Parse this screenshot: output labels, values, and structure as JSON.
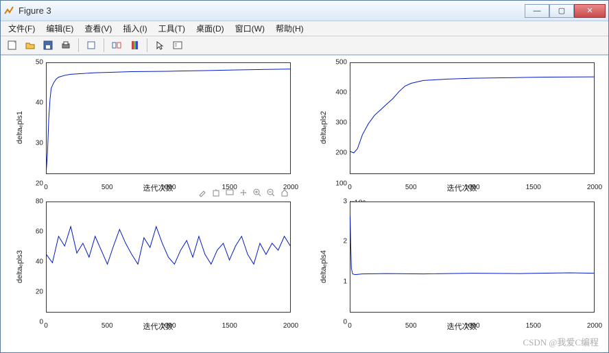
{
  "window": {
    "title": "Figure 3"
  },
  "menu": {
    "file": "文件(F)",
    "edit": "编辑(E)",
    "view": "查看(V)",
    "insert": "插入(I)",
    "tools": "工具(T)",
    "desktop": "桌面(D)",
    "window": "窗口(W)",
    "help": "帮助(H)"
  },
  "xlabel_common": "迭代次数",
  "watermark": "CSDN @我爱C编程",
  "axes_toolbar": {
    "brush": "brush",
    "export": "export",
    "copy": "copy",
    "pan": "pan",
    "zoomin": "zoom-in",
    "zoomout": "zoom-out",
    "home": "home"
  },
  "chart_data": [
    {
      "type": "line",
      "title": "",
      "xlabel": "迭代次数",
      "ylabel": "deltaₑpls1",
      "xlim": [
        0,
        2000
      ],
      "ylim": [
        20,
        50
      ],
      "xticks": [
        0,
        500,
        1000,
        1500,
        2000
      ],
      "yticks": [
        20,
        30,
        40,
        50
      ],
      "x": [
        0,
        10,
        20,
        30,
        40,
        60,
        80,
        100,
        150,
        200,
        300,
        400,
        500,
        700,
        1000,
        1300,
        1600,
        2000
      ],
      "values": [
        21,
        26,
        35,
        40,
        43,
        44.5,
        45.5,
        46,
        46.5,
        46.8,
        47,
        47.2,
        47.3,
        47.5,
        47.6,
        47.8,
        48,
        48.2
      ]
    },
    {
      "type": "line",
      "title": "",
      "xlabel": "迭代次数",
      "ylabel": "deltaₑpls2",
      "xlim": [
        0,
        2000
      ],
      "ylim": [
        100,
        500
      ],
      "xticks": [
        0,
        500,
        1000,
        1500,
        2000
      ],
      "yticks": [
        100,
        200,
        300,
        400,
        500
      ],
      "x": [
        0,
        30,
        60,
        100,
        150,
        200,
        250,
        300,
        350,
        400,
        450,
        500,
        600,
        800,
        1000,
        1300,
        1600,
        2000
      ],
      "values": [
        180,
        175,
        190,
        240,
        280,
        310,
        330,
        350,
        370,
        395,
        415,
        425,
        435,
        440,
        443,
        445,
        447,
        448
      ]
    },
    {
      "type": "line",
      "title": "",
      "xlabel": "迭代次数",
      "ylabel": "deltaₑpls3",
      "xlim": [
        0,
        2000
      ],
      "ylim": [
        0,
        80
      ],
      "xticks": [
        0,
        500,
        1000,
        1500,
        2000
      ],
      "yticks": [
        0,
        20,
        40,
        60,
        80
      ],
      "x": [
        0,
        50,
        100,
        150,
        200,
        250,
        300,
        350,
        400,
        450,
        500,
        550,
        600,
        650,
        700,
        750,
        800,
        850,
        900,
        950,
        1000,
        1050,
        1100,
        1150,
        1200,
        1250,
        1300,
        1350,
        1400,
        1450,
        1500,
        1550,
        1600,
        1650,
        1700,
        1750,
        1800,
        1850,
        1900,
        1950,
        2000
      ],
      "values": [
        42,
        36,
        55,
        48,
        62,
        43,
        50,
        40,
        55,
        45,
        35,
        48,
        60,
        50,
        42,
        35,
        54,
        47,
        62,
        50,
        40,
        35,
        45,
        52,
        40,
        55,
        42,
        35,
        45,
        50,
        38,
        48,
        55,
        42,
        35,
        50,
        42,
        50,
        45,
        55,
        48
      ]
    },
    {
      "type": "line",
      "title": "",
      "xlabel": "迭代次数",
      "ylabel": "deltaₑpls4",
      "xlim": [
        0,
        2000
      ],
      "ylim": [
        0,
        3
      ],
      "ymultiplier": "×10⁸",
      "xticks": [
        0,
        500,
        1000,
        1500,
        2000
      ],
      "yticks": [
        0,
        1,
        2,
        3
      ],
      "x": [
        0,
        5,
        10,
        20,
        40,
        100,
        300,
        600,
        1000,
        1400,
        1800,
        2000
      ],
      "values": [
        2.6,
        1.8,
        1.2,
        1.05,
        1.03,
        1.05,
        1.06,
        1.05,
        1.07,
        1.06,
        1.08,
        1.07
      ]
    }
  ]
}
